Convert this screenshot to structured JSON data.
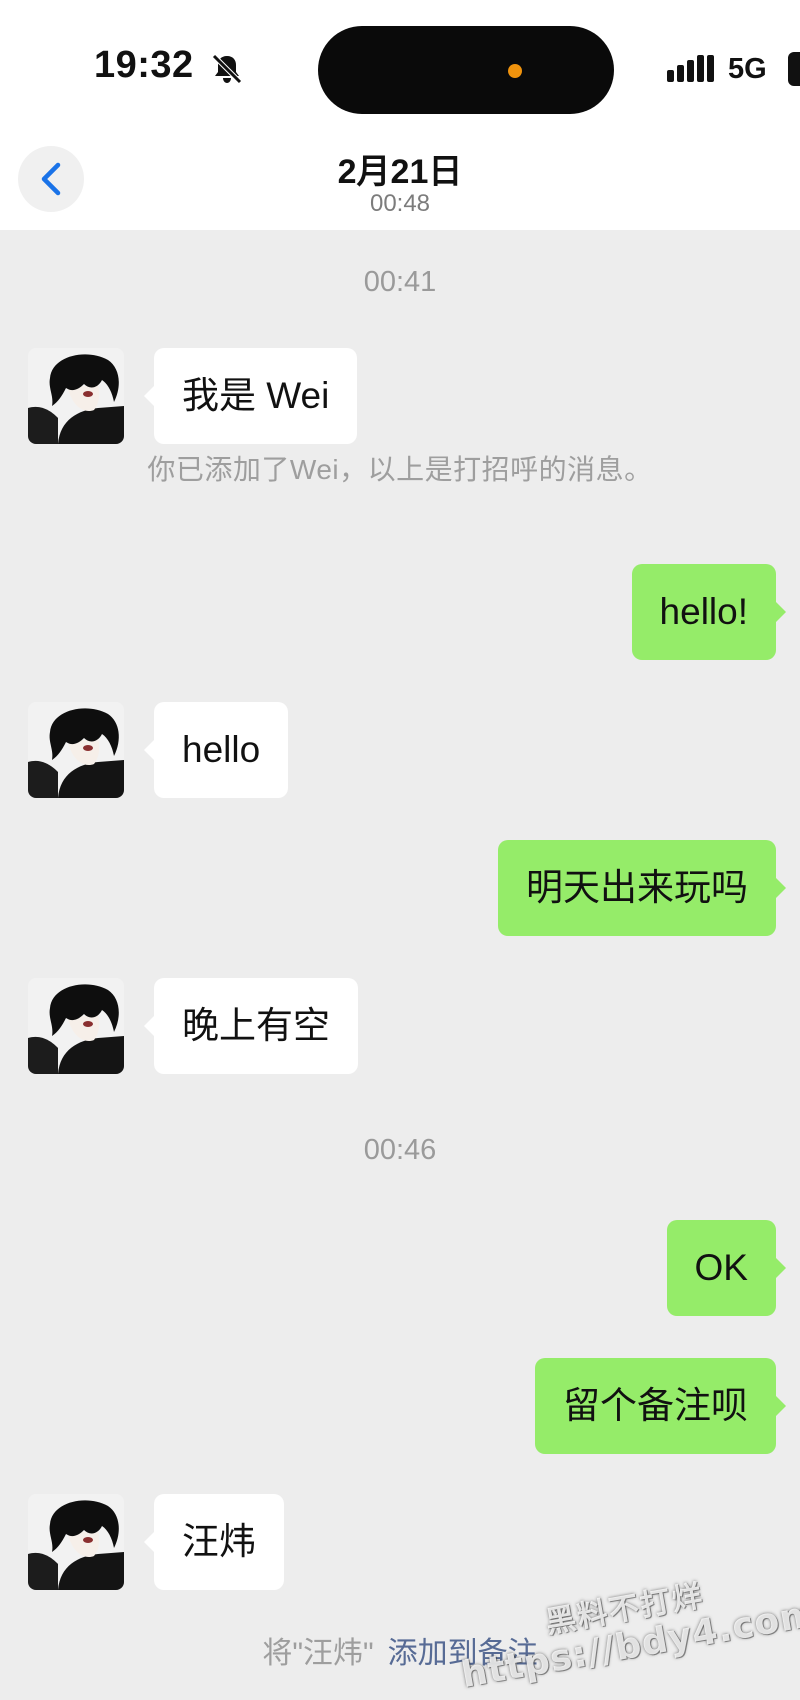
{
  "status_bar": {
    "time": "19:32",
    "network": "5G",
    "icons": [
      "bell-slash-icon",
      "signal-icon",
      "battery-icon"
    ],
    "island_dot_color": "#f0930d"
  },
  "header": {
    "title": "2月21日",
    "subtitle": "00:48",
    "back_icon": "chevron-left-icon",
    "accent_color": "#1a73e8"
  },
  "colors": {
    "background": "#ededed",
    "incoming_bubble": "#ffffff",
    "outgoing_bubble": "#95ec69",
    "link": "#576b95"
  },
  "chat": {
    "timestamps": [
      "00:41",
      "00:46"
    ],
    "system_notice": "你已添加了Wei，以上是打招呼的消息。",
    "messages": [
      {
        "from": "contact",
        "text": "我是 Wei"
      },
      {
        "from": "me",
        "text": "hello!"
      },
      {
        "from": "contact",
        "text": "hello"
      },
      {
        "from": "me",
        "text": "明天出来玩吗"
      },
      {
        "from": "contact",
        "text": "晚上有空"
      },
      {
        "from": "me",
        "text": "OK"
      },
      {
        "from": "me",
        "text": "留个备注呗"
      },
      {
        "from": "contact",
        "text": "汪炜"
      }
    ],
    "remark_prompt": {
      "text": "将\"汪炜\"",
      "link": "添加到备注"
    }
  },
  "watermark": {
    "line1": "黑料不打烊",
    "line2": "https://bdy4.com"
  }
}
